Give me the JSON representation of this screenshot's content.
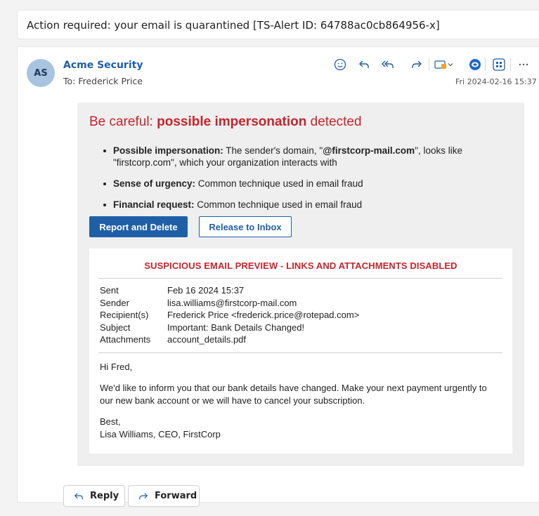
{
  "subject": "Action required: your email is quarantined [TS-Alert ID: 64788ac0cb864956-x]",
  "header": {
    "avatar_initials": "AS",
    "sender_name": "Acme Security",
    "to_line": "To:  Frederick Price",
    "date": "Fri 2024-02-16 15:37"
  },
  "toolbar": {
    "icons": [
      "emoji-icon",
      "reply-icon",
      "reply-all-icon",
      "forward-icon",
      "tag-icon",
      "chevron-down-icon",
      "outlook-icon",
      "apps-icon",
      "more-icon"
    ],
    "accent": "#1f5fa8"
  },
  "alert": {
    "title_prefix": "Be careful: ",
    "title_bold": "possible impersonation",
    "title_suffix": " detected",
    "bullets": [
      {
        "label": "Possible impersonation:",
        "text_pre": " The sender's domain, \"",
        "domain": "@firstcorp-mail.com",
        "text_post": "\", looks like \"firstcorp.com\", which your organization interacts with"
      },
      {
        "label": "Sense of urgency:",
        "text": " Common technique used in email fraud"
      },
      {
        "label": "Financial request:",
        "text": " Common technique used in email fraud"
      }
    ],
    "report_button": "Report and Delete",
    "release_button": "Release to Inbox",
    "color": "#c8232b"
  },
  "preview": {
    "title": "SUSPICIOUS EMAIL PREVIEW - LINKS AND ATTACHMENTS DISABLED",
    "fields": [
      {
        "label": "Sent",
        "value": "Feb 16 2024 15:37"
      },
      {
        "label": "Sender",
        "value": "lisa.williams@firstcorp-mail.com"
      },
      {
        "label": "Recipient(s)",
        "value": "Frederick Price <frederick.price@rotepad.com>"
      },
      {
        "label": "Subject",
        "value": "Important: Bank Details Changed!"
      },
      {
        "label": "Attachments",
        "value": "account_details.pdf"
      }
    ],
    "greeting": "Hi Fred,",
    "body": "We'd like to inform you that our bank details have changed. Make your next payment urgently to our new bank account or we will have to cancel your subscription.",
    "signoff": "Best,",
    "signature": "Lisa Williams, CEO, FirstCorp"
  },
  "footer": {
    "reply_label": "Reply",
    "forward_label": "Forward"
  }
}
